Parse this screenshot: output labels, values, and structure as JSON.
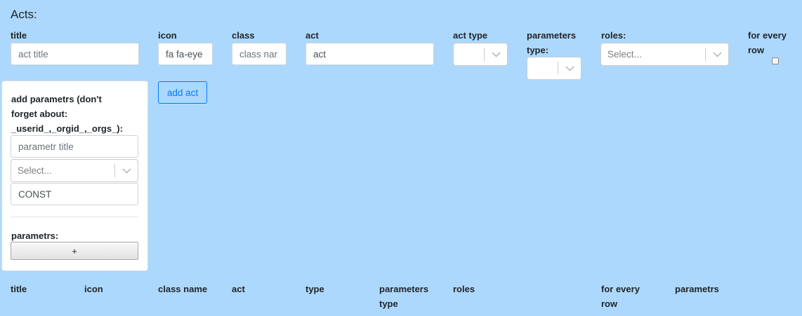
{
  "page": {
    "heading": "Acts:"
  },
  "form": {
    "title": {
      "label": "title",
      "placeholder": "act title"
    },
    "icon": {
      "label": "icon",
      "value": "fa fa-eye"
    },
    "class": {
      "label": "class",
      "placeholder": "class nar"
    },
    "act": {
      "label": "act",
      "value": "act"
    },
    "act_type": {
      "label": "act type",
      "value": ""
    },
    "parameters_type": {
      "label_line1": "parameters",
      "label_line2": "type:",
      "value": ""
    },
    "roles": {
      "label": "roles:",
      "placeholder": "Select..."
    },
    "for_every_row": {
      "label_line1": "for every",
      "label_line2": "row",
      "checked": false
    },
    "add_act_label": "add act"
  },
  "params_panel": {
    "title_line1": "add parametrs (don't",
    "title_line2": "forget about:",
    "title_line3": "_userid_,_orgid_,_orgs_):",
    "param_title_placeholder": "parametr title",
    "type_placeholder": "Select...",
    "const_value": "CONST",
    "list_label": "parametrs:",
    "add_label": "+"
  },
  "table": {
    "headers": [
      {
        "line1": "title",
        "line2": ""
      },
      {
        "line1": "icon",
        "line2": ""
      },
      {
        "line1": "class name",
        "line2": ""
      },
      {
        "line1": "act",
        "line2": ""
      },
      {
        "line1": "type",
        "line2": ""
      },
      {
        "line1": "parameters",
        "line2": "type"
      },
      {
        "line1": "roles",
        "line2": ""
      },
      {
        "line1": "for every",
        "line2": "row"
      },
      {
        "line1": "parametrs",
        "line2": ""
      }
    ]
  },
  "icons": {
    "dropdown": "chevron-down-icon",
    "checkbox": "checkbox-icon"
  },
  "colors": {
    "background": "#acd8fd",
    "accent": "#007bff"
  }
}
